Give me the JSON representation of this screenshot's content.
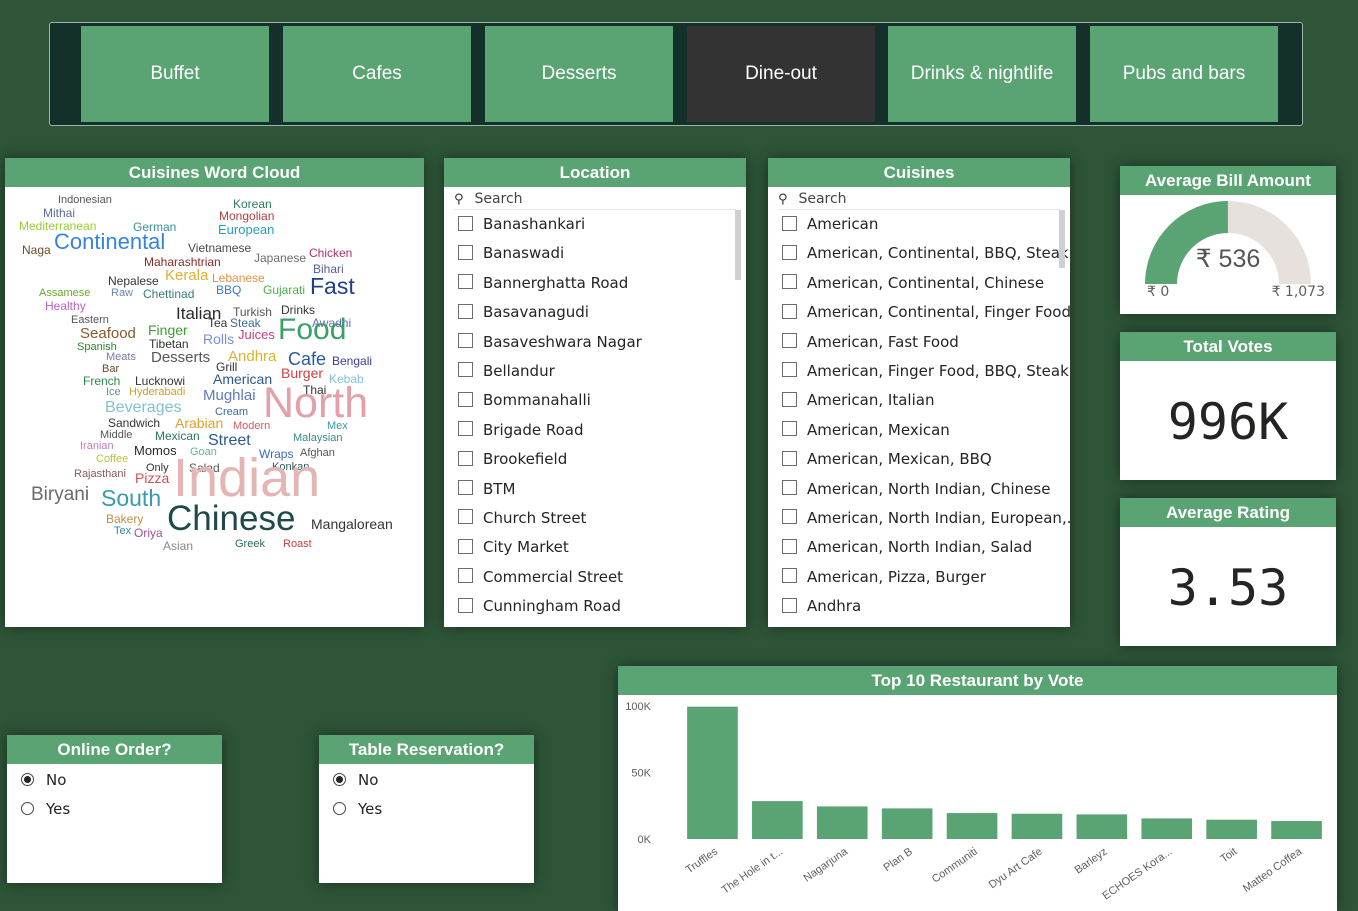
{
  "tabs": [
    {
      "label": "Buffet",
      "active": false
    },
    {
      "label": "Cafes",
      "active": false
    },
    {
      "label": "Desserts",
      "active": false
    },
    {
      "label": "Dine-out",
      "active": true
    },
    {
      "label": "Drinks & nightlife",
      "active": false
    },
    {
      "label": "Pubs and bars",
      "active": false
    }
  ],
  "word_cloud": {
    "title": "Cuisines Word Cloud",
    "words": [
      "Indonesian",
      "Korean",
      "Mithai",
      "Mongolian",
      "Mediterranean",
      "German",
      "European",
      "Naga",
      "Continental",
      "Vietnamese",
      "Chicken",
      "Maharashtrian",
      "Japanese",
      "Bihari",
      "Nepalese",
      "Kerala",
      "Lebanese",
      "Assamese",
      "Raw",
      "Chettinad",
      "BBQ",
      "Gujarati",
      "Fast",
      "Healthy",
      "Turkish",
      "Drinks",
      "Eastern",
      "Italian",
      "Tea",
      "Steak",
      "Awadhi",
      "Seafood",
      "Finger",
      "Juices",
      "Food",
      "Spanish",
      "Tibetan",
      "Rolls",
      "Meats",
      "Desserts",
      "Andhra",
      "Cafe",
      "Bengali",
      "Bar",
      "Grill",
      "Burger",
      "French",
      "Lucknowi",
      "American",
      "Kebab",
      "Ice",
      "Hyderabadi",
      "Mughlai",
      "Thai",
      "North",
      "Beverages",
      "Cream",
      "Sandwich",
      "Arabian",
      "Modern",
      "Mex",
      "Middle",
      "Mexican",
      "Street",
      "Malaysian",
      "Iranian",
      "Momos",
      "Goan",
      "Wraps",
      "Afghan",
      "Coffee",
      "Only",
      "Salad",
      "Konkan",
      "Rajasthani",
      "Pizza",
      "Indian",
      "Biryani",
      "South",
      "Bakery",
      "Chinese",
      "Mangalorean",
      "Tex",
      "Oriya",
      "Asian",
      "Greek",
      "Roast"
    ]
  },
  "location": {
    "title": "Location",
    "search_placeholder": "Search",
    "items": [
      "Banashankari",
      "Banaswadi",
      "Bannerghatta Road",
      "Basavanagudi",
      "Basaveshwara Nagar",
      "Bellandur",
      "Bommanahalli",
      "Brigade Road",
      "Brookefield",
      "BTM",
      "Church Street",
      "City Market",
      "Commercial Street",
      "Cunningham Road"
    ]
  },
  "cuisines": {
    "title": "Cuisines",
    "search_placeholder": "Search",
    "items": [
      "American",
      "American, Continental, BBQ, Steak",
      "American, Continental, Chinese",
      "American, Continental, Finger Food",
      "American, Fast Food",
      "American, Finger Food, BBQ, Steak",
      "American, Italian",
      "American, Mexican",
      "American, Mexican, BBQ",
      "American, North Indian, Chinese",
      "American, North Indian, European,...",
      "American, North Indian, Salad",
      "American, Pizza, Burger",
      "Andhra"
    ]
  },
  "avg_bill": {
    "title": "Average Bill Amount",
    "value_label": "₹ 536",
    "min_label": "₹ 0",
    "max_label": "₹ 1,073",
    "value": 536,
    "min": 0,
    "max": 1073,
    "colors": {
      "fill": "#5aa372",
      "track": "#e6e1dc"
    }
  },
  "total_votes": {
    "title": "Total Votes",
    "value": "996K"
  },
  "avg_rating": {
    "title": "Average Rating",
    "value": "3.53"
  },
  "online_order": {
    "title": "Online Order?",
    "options": [
      "No",
      "Yes"
    ],
    "selected": "No"
  },
  "table_reservation": {
    "title": "Table Reservation?",
    "options": [
      "No",
      "Yes"
    ],
    "selected": "No"
  },
  "chart_title": "Top 10 Restaurant by Vote",
  "chart_data": {
    "type": "bar",
    "title": "Top 10 Restaurant by Vote",
    "categories": [
      "Truffles",
      "The Hole in t...",
      "Nagarjuna",
      "Plan B",
      "Communiti",
      "Dyu Art Cafe",
      "Barleyz",
      "ECHOES Kora...",
      "Toit",
      "Matteo Coffea"
    ],
    "values": [
      99500,
      28500,
      24500,
      23000,
      19500,
      19000,
      18500,
      15500,
      14500,
      13500
    ],
    "y_ticks": [
      "0K",
      "50K",
      "100K"
    ],
    "ylim": [
      0,
      100000
    ],
    "xlabel": "",
    "ylabel": "",
    "color": "#5aa372",
    "grid": false
  }
}
